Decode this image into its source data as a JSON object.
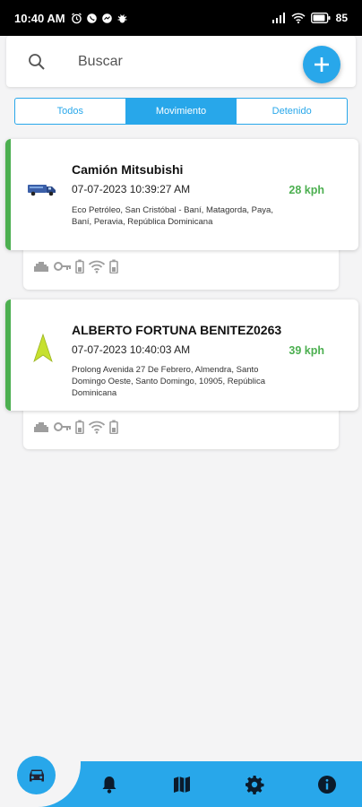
{
  "status_bar": {
    "time": "10:40 AM",
    "battery": "85"
  },
  "search": {
    "placeholder": "Buscar"
  },
  "add_button": {
    "icon": "plus-icon"
  },
  "tabs": [
    {
      "label": "Todos",
      "active": false
    },
    {
      "label": "Movimiento",
      "active": true
    },
    {
      "label": "Detenido",
      "active": false
    }
  ],
  "vehicles": [
    {
      "name": "Camión Mitsubishi",
      "datetime": "07-07-2023 10:39:27 AM",
      "address": "Eco Petróleo, San Cristóbal - Baní, Matagorda, Paya, Baní, Peravia, República Dominicana",
      "speed": "28 kph",
      "icon": "truck-icon",
      "status_icons": [
        "engine-icon",
        "key-icon",
        "battery-icon",
        "wifi-icon",
        "battery-small-icon"
      ]
    },
    {
      "name": "ALBERTO FORTUNA BENITEZ0263",
      "datetime": "07-07-2023 10:40:03 AM",
      "address": "Prolong Avenida 27 De Febrero, Almendra, Santo Domingo Oeste, Santo Domingo, 10905, República Dominicana",
      "speed": "39 kph",
      "icon": "navigation-arrow-icon",
      "status_icons": [
        "engine-icon",
        "key-icon",
        "battery-icon",
        "wifi-icon",
        "battery-small-icon"
      ]
    }
  ],
  "bottom_nav": [
    "car-icon",
    "bell-icon",
    "map-icon",
    "gear-icon",
    "info-icon"
  ],
  "colors": {
    "accent": "#28a7ea",
    "moving": "#4caf50"
  }
}
